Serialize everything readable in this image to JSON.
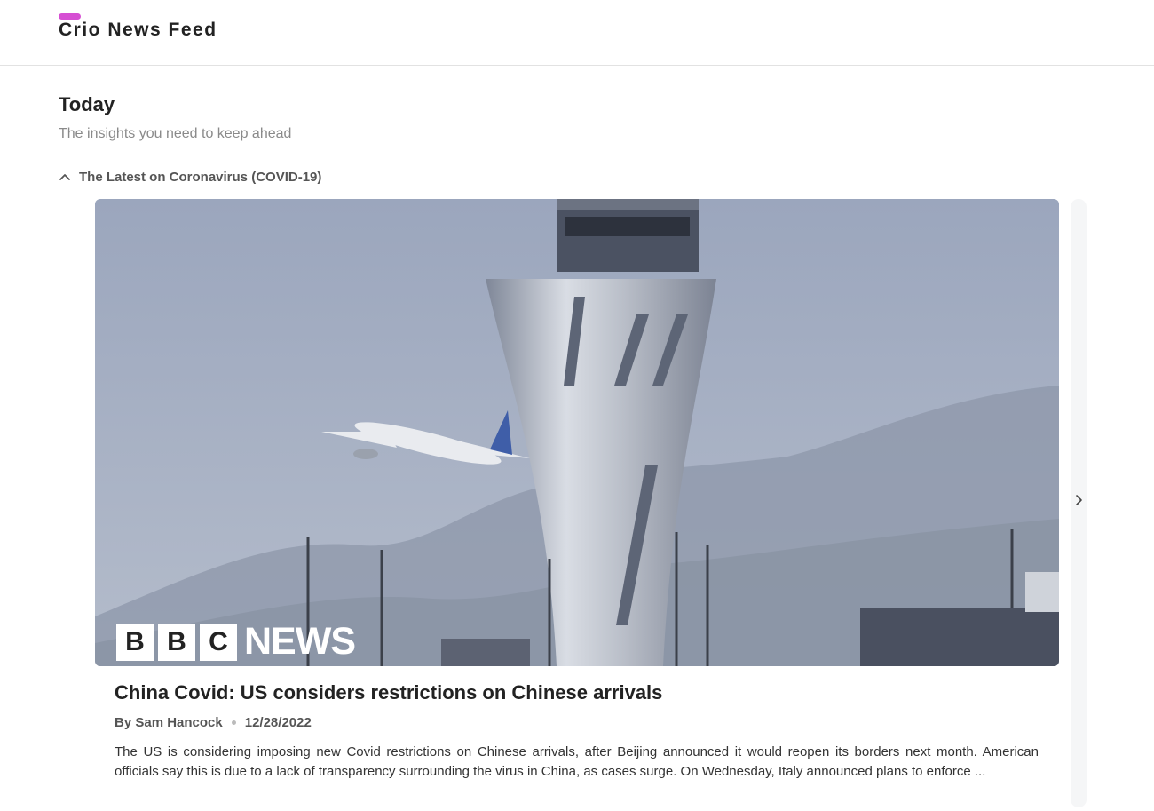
{
  "header": {
    "brand": "Crio News Feed",
    "accent_color": "#d64fd3"
  },
  "section": {
    "heading": "Today",
    "subheading": "The insights you need to keep ahead"
  },
  "topic": {
    "label": "The Latest on Coronavirus (COVID-19)",
    "expanded": true,
    "icon": "chevron-up-icon"
  },
  "article": {
    "source_logo_letters": [
      "B",
      "B",
      "C"
    ],
    "source_logo_word": "NEWS",
    "title": "China Covid: US considers restrictions on Chinese arrivals",
    "author": "By Sam Hancock",
    "date": "12/28/2022",
    "description": "The US is considering imposing new Covid restrictions on Chinese arrivals, after Beijing announced it would reopen its borders next month. American officials say this is due to a lack of transparency surrounding the virus in China, as cases surge. On Wednesday, Italy announced plans to enforce ..."
  },
  "carousel": {
    "next_icon": "chevron-right-icon"
  }
}
